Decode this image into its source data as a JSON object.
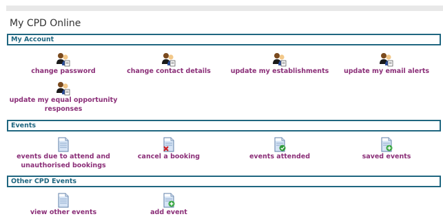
{
  "page": {
    "title": "My CPD Online"
  },
  "sections": [
    {
      "header": "My Account",
      "items": [
        {
          "label": "change password",
          "icon": "users-icon"
        },
        {
          "label": "change contact details",
          "icon": "users-icon"
        },
        {
          "label": "update my establishments",
          "icon": "users-icon"
        },
        {
          "label": "update my email alerts",
          "icon": "users-icon"
        },
        {
          "label": "update my equal opportunity",
          "label2": "responses",
          "icon": "users-icon"
        }
      ]
    },
    {
      "header": "Events",
      "items": [
        {
          "label": "events due to attend and",
          "label2": "unauthorised bookings",
          "icon": "document-icon"
        },
        {
          "label": "cancel a booking",
          "icon": "document-cancel-icon"
        },
        {
          "label": "events attended",
          "icon": "document-check-icon"
        },
        {
          "label": "saved events",
          "icon": "document-add-icon"
        }
      ]
    },
    {
      "header": "Other CPD Events",
      "items": [
        {
          "label": "view other events",
          "icon": "document-icon"
        },
        {
          "label": "add event",
          "icon": "document-add-icon"
        }
      ]
    }
  ],
  "colors": {
    "accent": "#1f6680",
    "link": "#8b2f78",
    "topbar": "#e8e8e8"
  }
}
